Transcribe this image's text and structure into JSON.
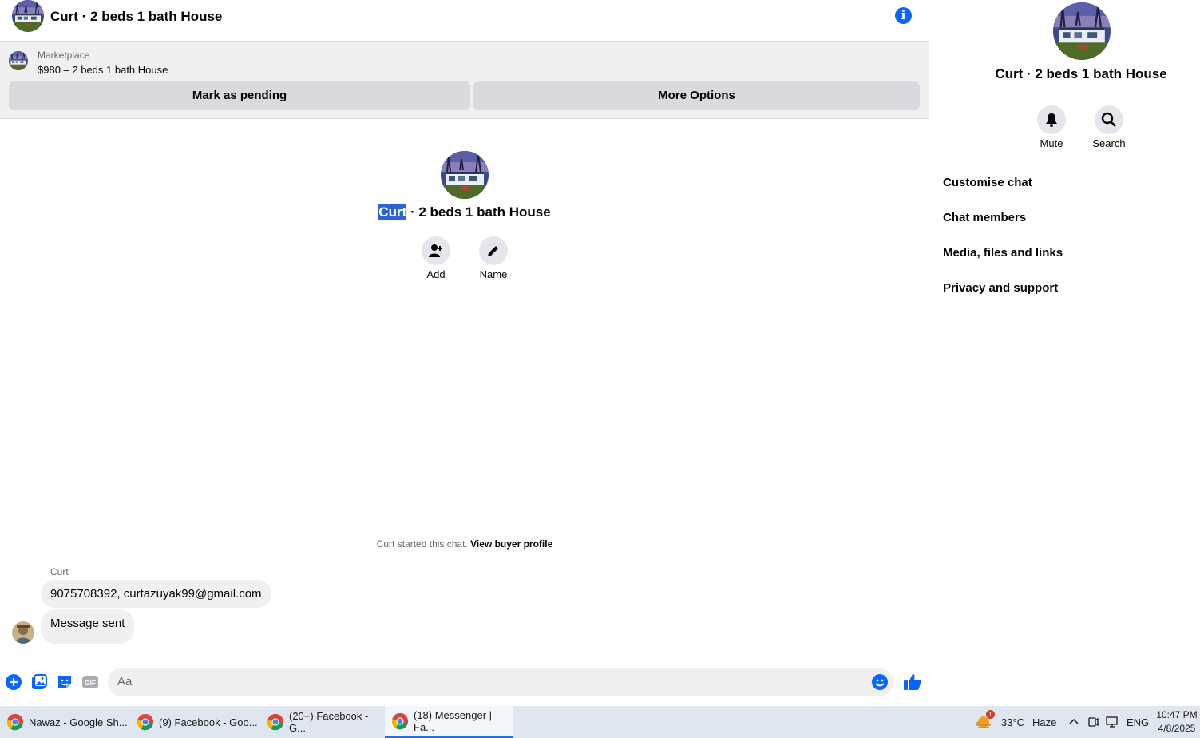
{
  "header": {
    "title": "Curt · 2 beds 1 bath House",
    "info_icon": "info-icon"
  },
  "marketplace": {
    "label": "Marketplace",
    "price_line": "$980 – 2 beds 1 bath House",
    "pending_button": "Mark as pending",
    "more_button": "More Options"
  },
  "intro": {
    "name_highlight": "Curt",
    "name_rest": " · 2 beds 1 bath House",
    "add_label": "Add",
    "name_label": "Name"
  },
  "conversation": {
    "started_text": "Curt started this chat.",
    "view_profile": "View buyer profile",
    "sender": "Curt",
    "messages": [
      "9075708392, curtazuyak99@gmail.com",
      "Message sent"
    ]
  },
  "composer": {
    "placeholder": "Aa",
    "icons": [
      "plus-icon",
      "photo-icon",
      "sticker-icon",
      "gif-icon",
      "emoji-icon",
      "like-icon"
    ],
    "gif_text": "GIF"
  },
  "panel": {
    "title": "Curt · 2 beds 1 bath House",
    "mute_label": "Mute",
    "search_label": "Search",
    "menu": [
      "Customise chat",
      "Chat members",
      "Media, files and links",
      "Privacy and support"
    ]
  },
  "taskbar": {
    "tasks": [
      "Nawaz - Google Sh...",
      "(9) Facebook - Goo...",
      "(20+) Facebook - G...",
      "(18) Messenger | Fa..."
    ],
    "weather_badge": "1",
    "temperature": "33°C",
    "weather": "Haze",
    "language": "ENG",
    "time": "10:47 PM",
    "date": "4/8/2025"
  },
  "colors": {
    "accent": "#0866ff",
    "bubble": "#f0f0f0",
    "highlight": "#2b62d4"
  }
}
